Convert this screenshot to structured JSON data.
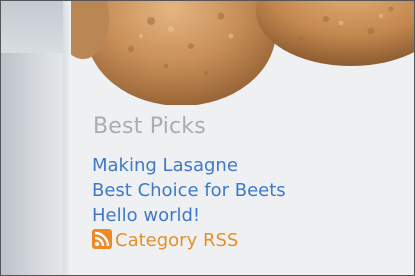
{
  "widget": {
    "title": "Best Picks",
    "links": [
      {
        "label": "Making Lasagne"
      },
      {
        "label": "Best Choice for Beets"
      },
      {
        "label": "Hello world!"
      }
    ],
    "rss": {
      "label": "Category RSS",
      "icon": "rss-feed-icon"
    }
  },
  "colors": {
    "link": "#3f79c7",
    "rss_link": "#e58f2c",
    "title": "#a9adb1",
    "background": "#eef0f2"
  }
}
